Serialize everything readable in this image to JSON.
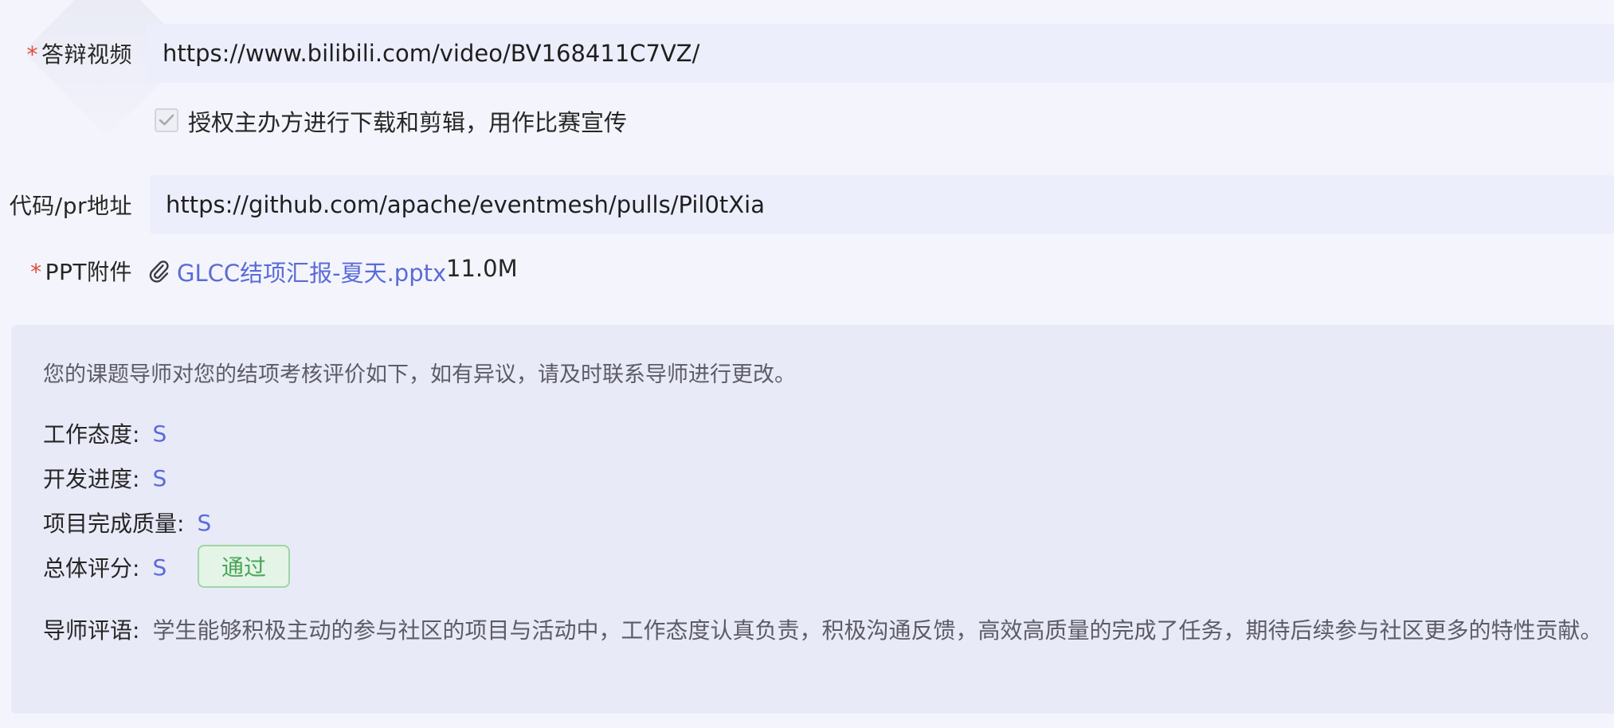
{
  "form": {
    "video": {
      "required_mark": "*",
      "label": "答辩视频",
      "value": "https://www.bilibili.com/video/BV168411C7VZ/"
    },
    "authorize": {
      "checked": true,
      "label": "授权主办方进行下载和剪辑，用作比赛宣传"
    },
    "code_pr": {
      "label": "代码/pr地址",
      "value": "https://github.com/apache/eventmesh/pulls/Pil0tXia"
    },
    "ppt": {
      "required_mark": "*",
      "label": "PPT附件",
      "icon": "paperclip-icon",
      "file_name": "GLCC结项汇报-夏天.pptx",
      "file_size": "11.0M"
    }
  },
  "evaluation": {
    "notice": "您的课题导师对您的结项考核评价如下，如有异议，请及时联系导师进行更改。",
    "work_attitude": {
      "label": "工作态度:",
      "grade": "S"
    },
    "dev_progress": {
      "label": "开发进度:",
      "grade": "S"
    },
    "quality": {
      "label": "项目完成质量:",
      "grade": "S"
    },
    "overall": {
      "label": "总体评分:",
      "grade": "S",
      "status": "通过"
    },
    "comment": {
      "label": "导师评语:",
      "text": "学生能够积极主动的参与社区的项目与活动中，工作态度认真负责，积极沟通反馈，高效高质量的完成了任务，期待后续参与社区更多的特性贡献。"
    }
  },
  "colors": {
    "accent": "#5a6bd8",
    "required": "#e24b3b",
    "pass_text": "#47a657",
    "pass_border": "#9fd6a6",
    "pass_bg": "#e4f4e6",
    "panel_bg": "#e9eaf8",
    "input_bg": "#eceefb"
  }
}
